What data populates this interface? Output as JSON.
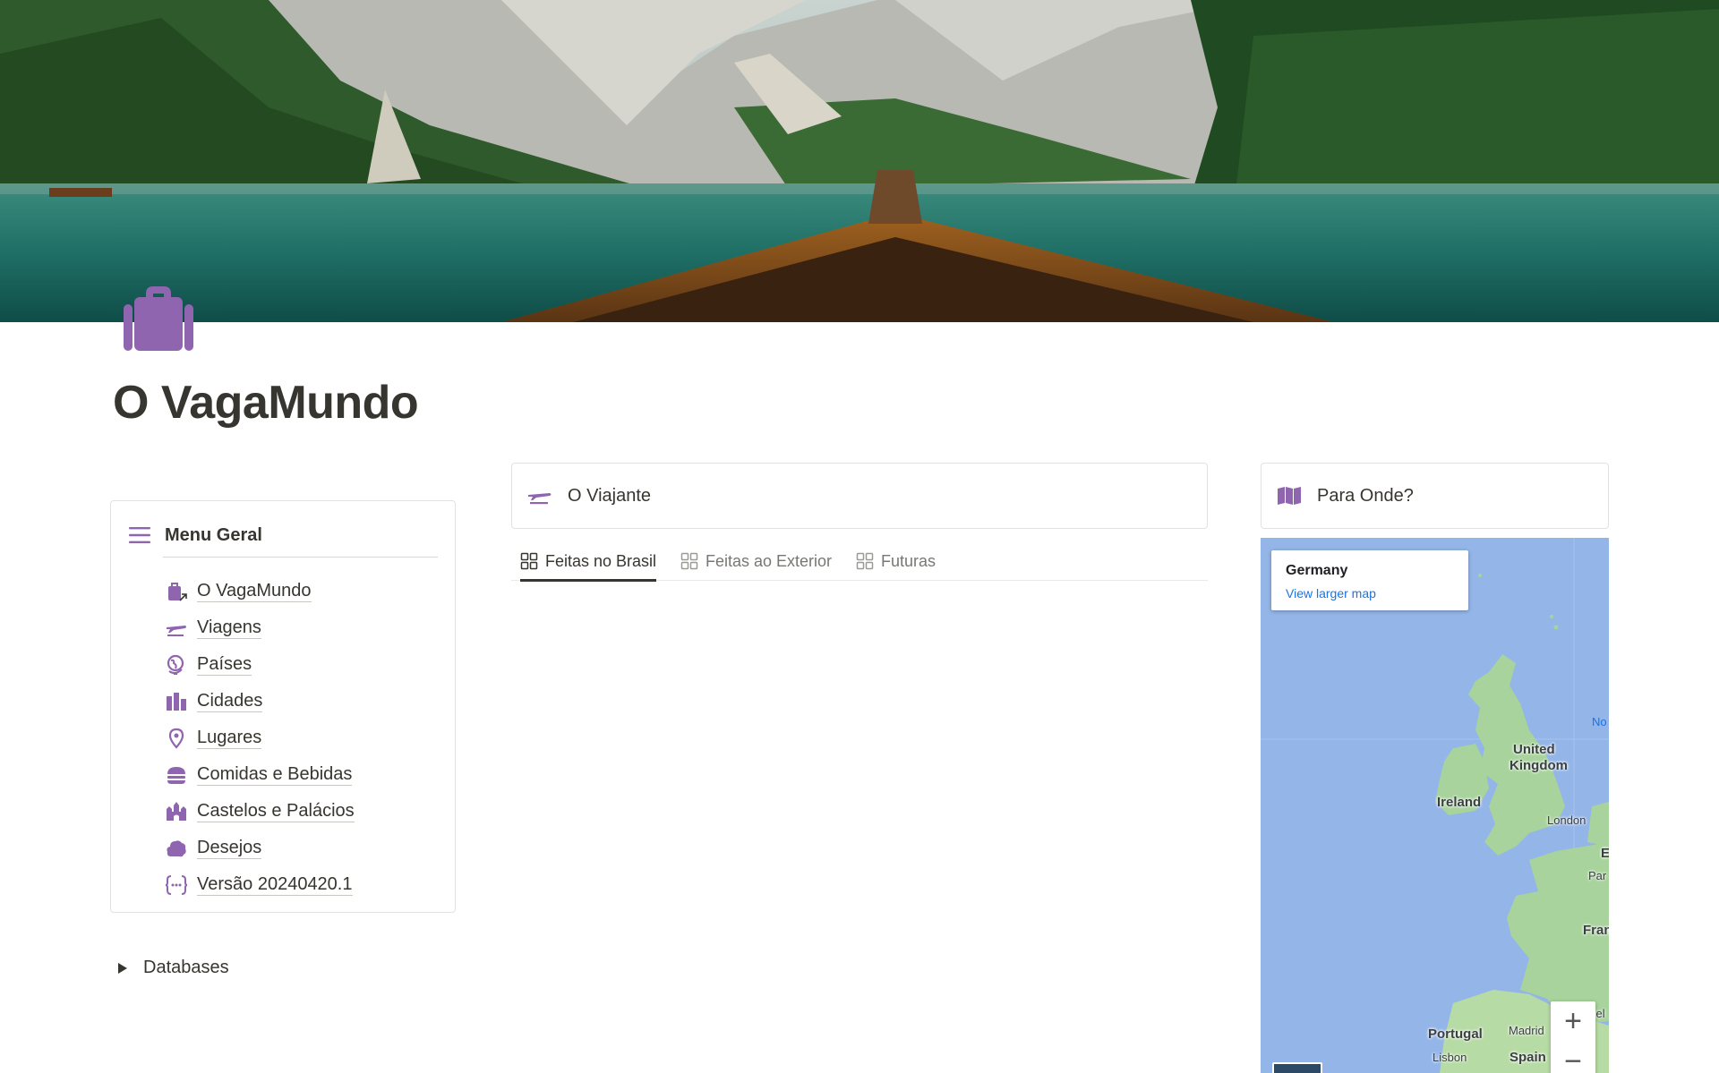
{
  "page": {
    "title": "O VagaMundo",
    "icon": "suitcase-icon",
    "accent_color": "#9065b0"
  },
  "menu": {
    "title": "Menu Geral",
    "items": [
      {
        "label": "O VagaMundo",
        "icon": "suitcase-link-icon"
      },
      {
        "label": "Viagens",
        "icon": "airplane-icon"
      },
      {
        "label": "Países",
        "icon": "globe-icon"
      },
      {
        "label": "Cidades",
        "icon": "city-icon"
      },
      {
        "label": "Lugares",
        "icon": "map-pin-icon"
      },
      {
        "label": "Comidas e Bebidas",
        "icon": "burger-icon"
      },
      {
        "label": "Castelos e Palácios",
        "icon": "castle-icon"
      },
      {
        "label": "Desejos",
        "icon": "cloud-icon"
      },
      {
        "label": "Versão 20240420.1",
        "icon": "code-braces-icon"
      }
    ]
  },
  "databases_toggle": {
    "label": "Databases"
  },
  "traveler": {
    "title": "O Viajante",
    "tabs": [
      {
        "label": "Feitas no Brasil",
        "active": true
      },
      {
        "label": "Feitas ao Exterior",
        "active": false
      },
      {
        "label": "Futuras",
        "active": false
      }
    ]
  },
  "destination": {
    "title": "Para Onde?",
    "map": {
      "place": "Germany",
      "link": "View larger map",
      "labels": {
        "united_kingdom_1": "United",
        "united_kingdom_2": "Kingdom",
        "ireland": "Ireland",
        "london": "London",
        "paris": "Par",
        "france": "Fran",
        "portugal": "Portugal",
        "madrid": "Madrid",
        "spain": "Spain",
        "lisbon": "Lisbon",
        "north_sea": "No",
        "b_partial": "E",
        "cel_partial": "cel"
      },
      "zoom_in": "+",
      "zoom_out": "−"
    }
  }
}
